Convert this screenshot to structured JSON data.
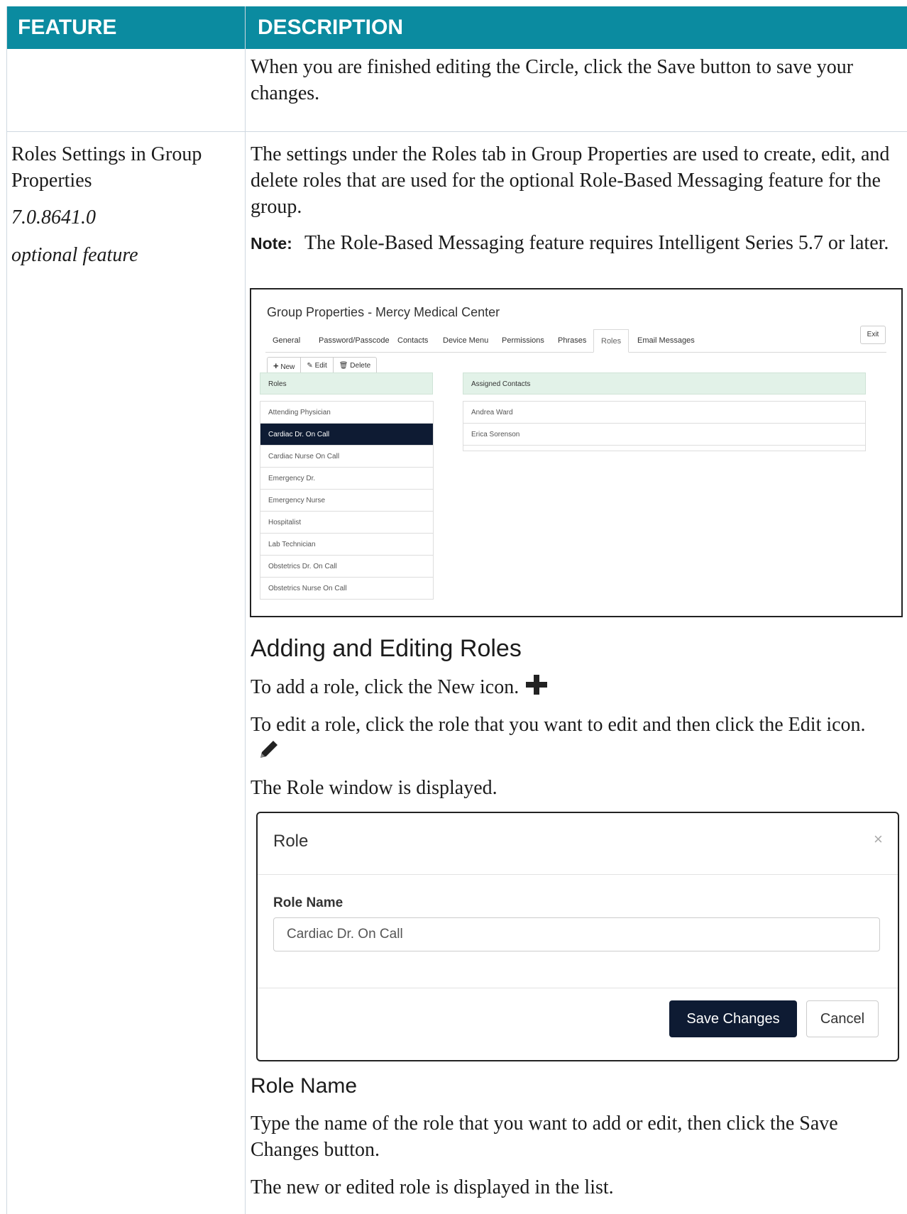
{
  "table": {
    "header": {
      "feature": "FEATURE",
      "description": "DESCRIPTION"
    },
    "row1": {
      "description": "When you are finished editing the Circle, click the Save button to save your changes."
    },
    "row2": {
      "feature_title": "Roles Settings in Group Properties",
      "version": "7.0.8641.0",
      "optional": "optional feature",
      "intro": "The settings under the Roles tab in Group Properties are used to create, edit, and delete roles that are used for the optional Role-Based Messaging feature for the group.",
      "note_label": "Note:",
      "note_text": "The Role-Based Messaging feature requires Intelligent Series 5.7 or later.",
      "section_heading": "Adding and Editing Roles",
      "add_text": "To add a role, click the New icon.",
      "edit_text": "To edit a role, click the role that you want to edit and then click the Edit icon.",
      "role_window_text": "The Role window is displayed.",
      "subheading": "Role Name",
      "type_text": "Type the name of the role that you want to add or edit, then click the Save Changes button.",
      "result_text": "The new or edited role is displayed in the list."
    }
  },
  "group_properties": {
    "title": "Group Properties - Mercy Medical Center",
    "tabs": [
      "General",
      "Password/Passcode",
      "Contacts",
      "Device Menu",
      "Permissions",
      "Phrases",
      "Roles",
      "Email Messages"
    ],
    "active_tab": "Roles",
    "exit_label": "Exit",
    "toolbar": {
      "new": "New",
      "edit": "Edit",
      "delete": "Delete"
    },
    "roles_header": "Roles",
    "roles": [
      "Attending Physician",
      "Cardiac Dr. On Call",
      "Cardiac Nurse On Call",
      "Emergency Dr.",
      "Emergency Nurse",
      "Hospitalist",
      "Lab Technician",
      "Obstetrics Dr. On Call",
      "Obstetrics Nurse On Call"
    ],
    "selected_role": "Cardiac Dr. On Call",
    "contacts_header": "Assigned Contacts",
    "contacts": [
      "Andrea Ward",
      "Erica Sorenson"
    ]
  },
  "role_dialog": {
    "title": "Role",
    "close_glyph": "×",
    "field_label": "Role Name",
    "field_value": "Cardiac Dr. On Call",
    "save_label": "Save Changes",
    "cancel_label": "Cancel"
  },
  "icons": {
    "plus": "plus-icon",
    "pencil": "pencil-icon",
    "trash": "trash-icon"
  },
  "colors": {
    "header_bg": "#0b8ba0",
    "selected_bg": "#0e1b33",
    "panel_head_bg": "#e2f2e8"
  }
}
